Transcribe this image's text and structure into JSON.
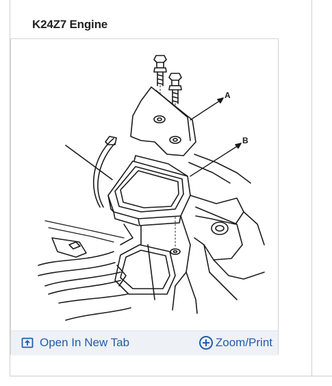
{
  "section": {
    "heading": "K24Z7 Engine"
  },
  "figure": {
    "callouts": [
      "A",
      "B"
    ]
  },
  "toolbar": {
    "open_tab_label": "Open In New Tab",
    "open_tab_icon": "open-in-new-tab-icon",
    "zoom_label": "Zoom/Print",
    "zoom_icon": "plus-circle-icon",
    "link_color": "#1f5cab",
    "background_color": "#eef1f6"
  }
}
